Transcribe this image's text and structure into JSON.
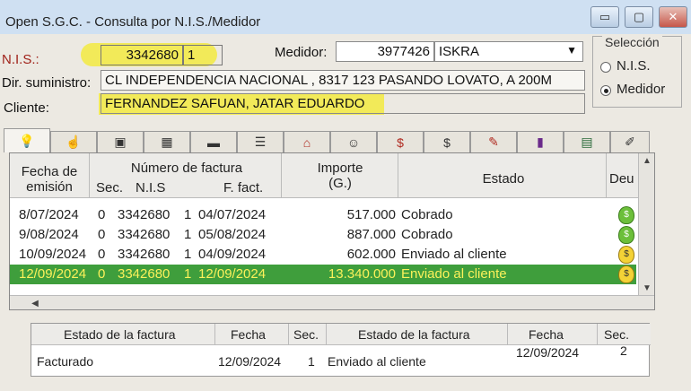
{
  "window": {
    "title": "Open S.G.C. - Consulta por N.I.S./Medidor",
    "buttons": {
      "minimize": "▭",
      "maximize": "▢",
      "close": "✕"
    }
  },
  "form": {
    "nis_label": "N.I.S.:",
    "nis_value": "3342680",
    "nis_seq": "1",
    "medidor_label": "Medidor:",
    "medidor_value": "3977426",
    "medidor_brand": "ISKRA",
    "direccion_label": "Dir. suministro:",
    "direccion_value": "CL INDEPENDENCIA NACIONAL , 8317  123 PASANDO LOVATO, A 200M",
    "cliente_label": "Cliente:",
    "cliente_value": "FERNANDEZ SAFUAN, JATAR EDUARDO"
  },
  "seleccion": {
    "caption": "Selección",
    "options": [
      "N.I.S.",
      "Medidor"
    ],
    "selected": "Medidor"
  },
  "tabs": [
    {
      "icon": "lightbulb-icon",
      "glyph": "💡"
    },
    {
      "icon": "hand-icon",
      "glyph": "☝"
    },
    {
      "icon": "monitor-icon",
      "glyph": "▣"
    },
    {
      "icon": "calculator-icon",
      "glyph": "▦"
    },
    {
      "icon": "meter-icon",
      "glyph": "▬"
    },
    {
      "icon": "document-icon",
      "glyph": "☰"
    },
    {
      "icon": "house-icon",
      "glyph": "⌂"
    },
    {
      "icon": "person-icon",
      "glyph": "☺"
    },
    {
      "icon": "money-bag-icon",
      "glyph": "$"
    },
    {
      "icon": "dollar-icon",
      "glyph": "$"
    },
    {
      "icon": "invoice-icon",
      "glyph": "✎"
    },
    {
      "icon": "bar-chart-icon",
      "glyph": "▮"
    },
    {
      "icon": "table-icon",
      "glyph": "▤"
    },
    {
      "icon": "pencil-icon",
      "glyph": "✐"
    }
  ],
  "grid": {
    "headers": {
      "fecha": "Fecha de emisión",
      "fecha_l1": "Fecha de",
      "fecha_l2": "emisión",
      "numero": "Número de factura",
      "sec": "Sec.",
      "nis": "N.I.S",
      "ffact": "F. fact.",
      "importe_l1": "Importe",
      "importe_l2": "(G.)",
      "estado": "Estado",
      "deuda": "Deu"
    },
    "rows": [
      {
        "fecha": "8/07/2024",
        "sec": "0",
        "nis": "3342680",
        "n": "1",
        "ffact": "04/07/2024",
        "importe": "517.000",
        "estado": "Cobrado",
        "deuda": "green"
      },
      {
        "fecha": "9/08/2024",
        "sec": "0",
        "nis": "3342680",
        "n": "1",
        "ffact": "05/08/2024",
        "importe": "887.000",
        "estado": "Cobrado",
        "deuda": "green"
      },
      {
        "fecha": "10/09/2024",
        "sec": "0",
        "nis": "3342680",
        "n": "1",
        "ffact": "04/09/2024",
        "importe": "602.000",
        "estado": "Enviado al cliente",
        "deuda": "yellow"
      },
      {
        "fecha": "12/09/2024",
        "sec": "0",
        "nis": "3342680",
        "n": "1",
        "ffact": "12/09/2024",
        "importe": "13.340.000",
        "estado": "Enviado al cliente",
        "deuda": "yellow",
        "selected": true
      }
    ]
  },
  "detail": {
    "headers": {
      "estado_factura": "Estado de la factura",
      "fecha": "Fecha",
      "sec": "Sec.",
      "estado_factura2": "Estado de la factura",
      "fecha2": "Fecha",
      "sec2": "Sec."
    },
    "values": {
      "estado_factura": "Facturado",
      "fecha": "12/09/2024",
      "sec": "1",
      "estado_factura2": "Enviado al cliente",
      "fecha2": "12/09/2024",
      "sec2": "2"
    }
  },
  "colors": {
    "selected_row": "#3f9e3c",
    "selected_text": "#fbf15a",
    "highlight": "#f3ea4a"
  }
}
